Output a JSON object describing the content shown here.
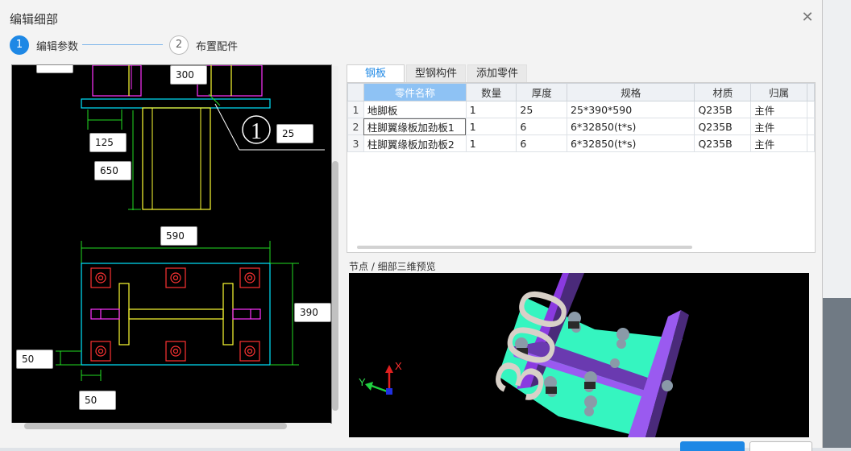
{
  "dialog": {
    "title": "编辑细部",
    "close_glyph": "✕"
  },
  "steps": [
    {
      "num": "1",
      "label": "编辑参数"
    },
    {
      "num": "2",
      "label": "布置配件"
    }
  ],
  "drawing": {
    "dims": [
      "300",
      "25",
      "125",
      "650",
      "590",
      "390",
      "50",
      "50"
    ],
    "callout": "1"
  },
  "tabs": [
    "钢板",
    "型钢构件",
    "添加零件"
  ],
  "grid": {
    "columns": [
      "零件名称",
      "数量",
      "厚度",
      "规格",
      "材质",
      "归属"
    ],
    "rows": [
      {
        "no": "1",
        "name": "地脚板",
        "qty": "1",
        "thick": "25",
        "spec": "25*390*590",
        "material": "Q235B",
        "owner": "主件"
      },
      {
        "no": "2",
        "name": "柱脚翼缘板加劲板1",
        "qty": "1",
        "thick": "6",
        "spec": "6*32850(t*s)",
        "material": "Q235B",
        "owner": "主件"
      },
      {
        "no": "3",
        "name": "柱脚翼缘板加劲板2",
        "qty": "1",
        "thick": "6",
        "spec": "6*32850(t*s)",
        "material": "Q235B",
        "owner": "主件"
      }
    ]
  },
  "preview": {
    "label": "节点 / 细部三维预览",
    "text3d": "300",
    "axis_x": "X",
    "axis_y": "Y"
  },
  "colors": {
    "accent": "#1e88e5",
    "plate": "#35f5c0",
    "stiffener": "#4a2a7a",
    "cad_cyan": "#00e5ff",
    "cad_yellow": "#ffff33",
    "cad_green": "#22dd22",
    "cad_magenta": "#ff33ff",
    "cad_red": "#ff3333"
  }
}
